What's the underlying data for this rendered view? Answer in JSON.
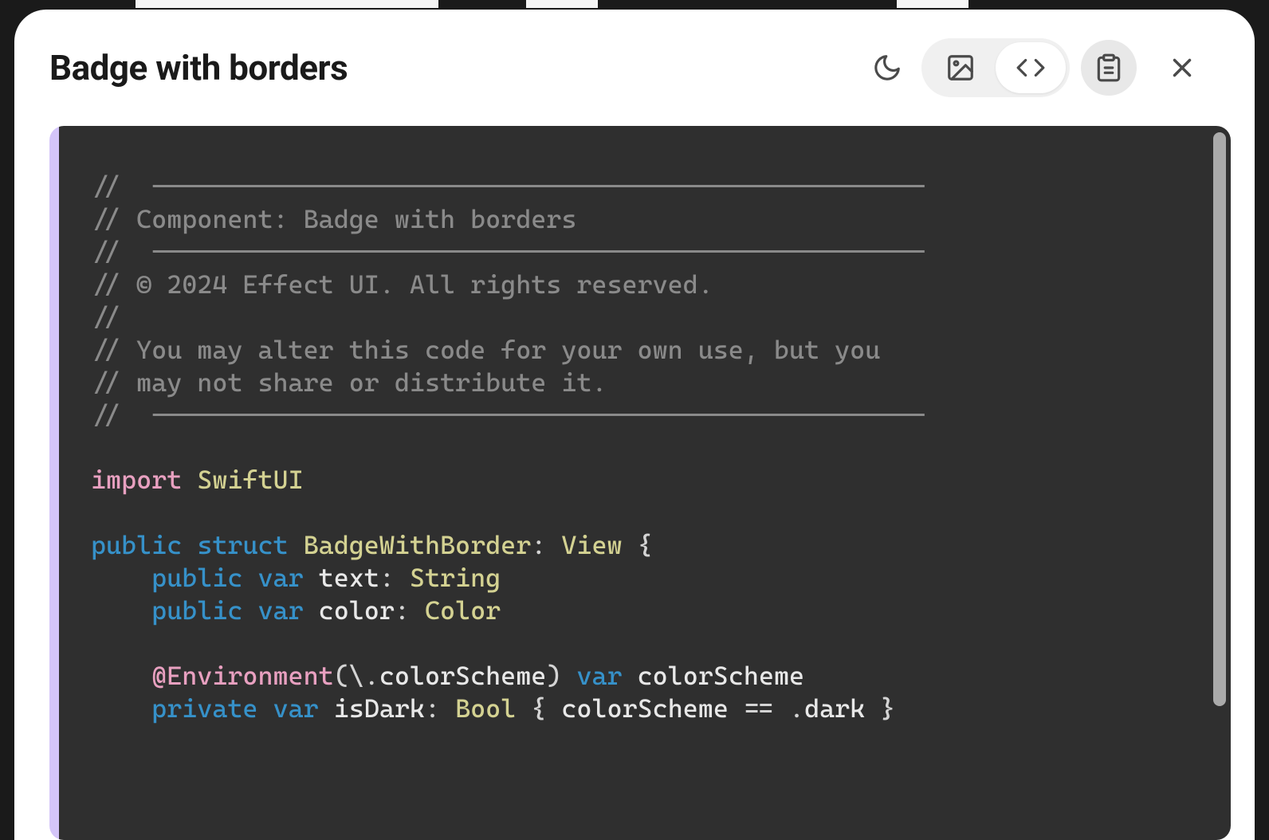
{
  "modal": {
    "title": "Badge with borders"
  },
  "toolbar": {
    "theme_icon": "moon",
    "view_image_icon": "image",
    "view_code_icon": "code",
    "copy_icon": "clipboard",
    "close_icon": "x",
    "active_view": "code"
  },
  "code": {
    "accent_color": "#d4c5f9",
    "background": "#2f2f2f",
    "lines": [
      {
        "type": "comment",
        "text": "//  ---------------------------------------------------"
      },
      {
        "type": "comment",
        "text": "// Component: Badge with borders"
      },
      {
        "type": "comment",
        "text": "//  ---------------------------------------------------"
      },
      {
        "type": "comment",
        "text": "// © 2024 Effect UI. All rights reserved."
      },
      {
        "type": "comment",
        "text": "//"
      },
      {
        "type": "comment",
        "text": "// You may alter this code for your own use, but you"
      },
      {
        "type": "comment",
        "text": "// may not share or distribute it."
      },
      {
        "type": "comment",
        "text": "//  ---------------------------------------------------"
      },
      {
        "type": "blank",
        "text": ""
      },
      {
        "type": "code",
        "tokens": [
          {
            "c": "keyword",
            "t": "import"
          },
          {
            "c": "punc",
            "t": " "
          },
          {
            "c": "type",
            "t": "SwiftUI"
          }
        ]
      },
      {
        "type": "blank",
        "text": ""
      },
      {
        "type": "code",
        "tokens": [
          {
            "c": "keyword2",
            "t": "public"
          },
          {
            "c": "punc",
            "t": " "
          },
          {
            "c": "keyword2",
            "t": "struct"
          },
          {
            "c": "punc",
            "t": " "
          },
          {
            "c": "type",
            "t": "BadgeWithBorder"
          },
          {
            "c": "punc",
            "t": ": "
          },
          {
            "c": "type",
            "t": "View"
          },
          {
            "c": "punc",
            "t": " {"
          }
        ]
      },
      {
        "type": "code",
        "tokens": [
          {
            "c": "punc",
            "t": "    "
          },
          {
            "c": "keyword2",
            "t": "public"
          },
          {
            "c": "punc",
            "t": " "
          },
          {
            "c": "keyword2",
            "t": "var"
          },
          {
            "c": "punc",
            "t": " "
          },
          {
            "c": "prop",
            "t": "text"
          },
          {
            "c": "punc",
            "t": ": "
          },
          {
            "c": "type",
            "t": "String"
          }
        ]
      },
      {
        "type": "code",
        "tokens": [
          {
            "c": "punc",
            "t": "    "
          },
          {
            "c": "keyword2",
            "t": "public"
          },
          {
            "c": "punc",
            "t": " "
          },
          {
            "c": "keyword2",
            "t": "var"
          },
          {
            "c": "punc",
            "t": " "
          },
          {
            "c": "prop",
            "t": "color"
          },
          {
            "c": "punc",
            "t": ": "
          },
          {
            "c": "type",
            "t": "Color"
          }
        ]
      },
      {
        "type": "blank",
        "text": ""
      },
      {
        "type": "code",
        "tokens": [
          {
            "c": "punc",
            "t": "    "
          },
          {
            "c": "keyword",
            "t": "@Environment"
          },
          {
            "c": "punc",
            "t": "(\\."
          },
          {
            "c": "prop",
            "t": "colorScheme"
          },
          {
            "c": "punc",
            "t": ") "
          },
          {
            "c": "keyword2",
            "t": "var"
          },
          {
            "c": "punc",
            "t": " "
          },
          {
            "c": "prop",
            "t": "colorScheme"
          }
        ]
      },
      {
        "type": "code",
        "tokens": [
          {
            "c": "punc",
            "t": "    "
          },
          {
            "c": "keyword2",
            "t": "private"
          },
          {
            "c": "punc",
            "t": " "
          },
          {
            "c": "keyword2",
            "t": "var"
          },
          {
            "c": "punc",
            "t": " "
          },
          {
            "c": "prop",
            "t": "isDark"
          },
          {
            "c": "punc",
            "t": ": "
          },
          {
            "c": "type",
            "t": "Bool"
          },
          {
            "c": "punc",
            "t": " { "
          },
          {
            "c": "prop",
            "t": "colorScheme"
          },
          {
            "c": "punc",
            "t": " == ."
          },
          {
            "c": "prop",
            "t": "dark"
          },
          {
            "c": "punc",
            "t": " }"
          }
        ]
      }
    ]
  }
}
